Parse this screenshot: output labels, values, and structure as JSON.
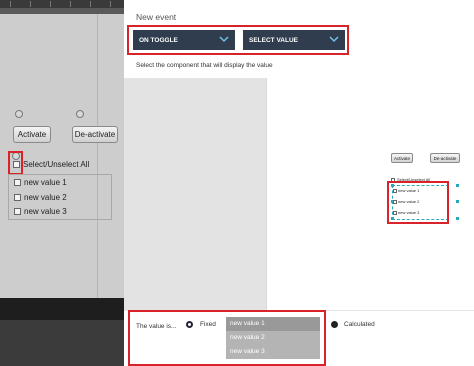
{
  "background": {
    "activate_label": "Activate",
    "deactivate_label": "De-activate",
    "select_all_label": "Select/Unselect All",
    "items": [
      "new value 1",
      "new value 2",
      "new value 3"
    ]
  },
  "dialog": {
    "title": "New event",
    "trigger_dropdown": "ON TOGGLE",
    "action_dropdown": "SELECT VALUE",
    "instruction": "Select the component that will display the value",
    "preview": {
      "activate_label": "Activate",
      "deactivate_label": "De-activate",
      "select_all_label": "Select/Unselect All",
      "items": [
        "new value 1",
        "new value 2",
        "new value 3"
      ]
    },
    "footer": {
      "value_label": "The value is...",
      "fixed_label": "Fixed",
      "calculated_label": "Calculated",
      "values": [
        "new value 1",
        "new value 2",
        "new value 3"
      ]
    }
  },
  "colors": {
    "highlight": "#d8232a",
    "dropdown_bg": "#2f3d4f",
    "selection_dashed": "#2aa7b8"
  }
}
